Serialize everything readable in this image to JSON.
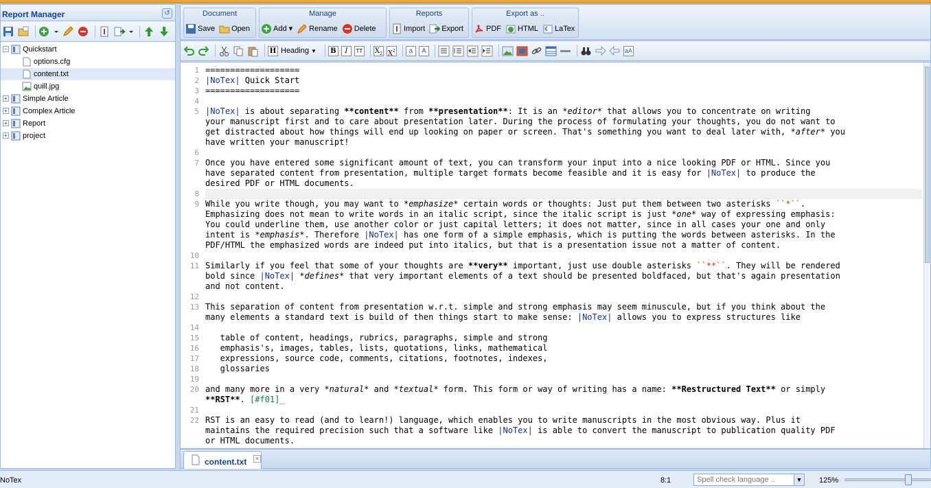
{
  "left_panel": {
    "title": "Report Manager",
    "tree": [
      {
        "label": "Quickstart",
        "type": "folder",
        "expanded": true
      },
      {
        "label": "options.cfg",
        "type": "file"
      },
      {
        "label": "content.txt",
        "type": "file",
        "selected": true
      },
      {
        "label": "quill.jpg",
        "type": "image"
      },
      {
        "label": "Simple Article",
        "type": "folder"
      },
      {
        "label": "Complex Article",
        "type": "folder"
      },
      {
        "label": "Report",
        "type": "folder"
      },
      {
        "label": "project",
        "type": "folder"
      }
    ]
  },
  "ribbon": {
    "document": {
      "title": "Document",
      "save": "Save",
      "open": "Open"
    },
    "manage": {
      "title": "Manage",
      "add": "Add",
      "rename": "Rename",
      "delete": "Delete"
    },
    "reports": {
      "title": "Reports",
      "import": "Import",
      "export": "Export"
    },
    "export_as": {
      "title": "Export as ..",
      "pdf": "PDF",
      "html": "HTML",
      "latex": "LaTex"
    }
  },
  "format_toolbar": {
    "heading": "Heading",
    "bold": "B",
    "italic": "I",
    "tt": "TT",
    "sub": "X",
    "sup": "X"
  },
  "editor": {
    "lines": [
      {
        "n": "1",
        "t": "==================="
      },
      {
        "n": "2",
        "t": "|NoTex| Quick Start"
      },
      {
        "n": "3",
        "t": "==================="
      },
      {
        "n": "4",
        "t": ""
      },
      {
        "n": "5",
        "t": "|NoTex| is about separating **content** from **presentation**: It is an *editor* that allows you to concentrate on writing"
      },
      {
        "n": "",
        "t": "your manuscript first and to care about presentation later. During the process of formulating your thoughts, you do not want to"
      },
      {
        "n": "",
        "t": "get distracted about how things will end up looking on paper or screen. That's something you want to deal later with, *after* you"
      },
      {
        "n": "",
        "t": "have written your manuscript!"
      },
      {
        "n": "6",
        "t": ""
      },
      {
        "n": "7",
        "t": "Once you have entered some significant amount of text, you can transform your input into a nice looking PDF or HTML. Since you"
      },
      {
        "n": "",
        "t": "have separated content from presentation, multiple target formats become feasible and it is easy for |NoTex| to produce the"
      },
      {
        "n": "",
        "t": "desired PDF or HTML documents."
      },
      {
        "n": "8",
        "t": ""
      },
      {
        "n": "9",
        "t": "While you write though, you may want to *emphasize* certain words or thoughts: Just put them between two asterisks ``*``."
      },
      {
        "n": "",
        "t": "Emphasizing does not mean to write words in an italic script, since the italic script is just *one* way of expressing emphasis:"
      },
      {
        "n": "",
        "t": "You could underline them, use another color or just capital letters; it does not matter, since in all cases your one and only"
      },
      {
        "n": "",
        "t": "intent is *emphasis*. Therefore |NoTex| has one form of a simple emphasis, which is putting the words between asterisks. In the"
      },
      {
        "n": "",
        "t": "PDF/HTML the emphasized words are indeed put into italics, but that is a presentation issue not a matter of content."
      },
      {
        "n": "10",
        "t": ""
      },
      {
        "n": "11",
        "t": "Similarly if you feel that some of your thoughts are **very** important, just use double asterisks ``**``. They will be rendered"
      },
      {
        "n": "",
        "t": "bold since |NoTex| *defines* that very important elements of a text should be presented boldfaced, but that's again presentation"
      },
      {
        "n": "",
        "t": "and not content."
      },
      {
        "n": "12",
        "t": ""
      },
      {
        "n": "13",
        "t": "This separation of content from presentation w.r.t. simple and strong emphasis may seem minuscule, but if you think about the"
      },
      {
        "n": "",
        "t": "many elements a standard text is build of then things start to make sense: |NoTex| allows you to express structures like"
      },
      {
        "n": "14",
        "t": ""
      },
      {
        "n": "15",
        "t": "   table of content, headings, rubrics, paragraphs, simple and strong"
      },
      {
        "n": "16",
        "t": "   emphasis's, images, tables, lists, quotations, links, mathematical"
      },
      {
        "n": "17",
        "t": "   expressions, source code, comments, citations, footnotes, indexes,"
      },
      {
        "n": "18",
        "t": "   glossaries"
      },
      {
        "n": "19",
        "t": ""
      },
      {
        "n": "20",
        "t": "and many more in a very *natural* and *textual* form. This form or way of writing has a name: **Restructured Text** or simply"
      },
      {
        "n": "",
        "t": "**RST**. [#f01]_"
      },
      {
        "n": "21",
        "t": ""
      },
      {
        "n": "22",
        "t": "RST is an easy to read (and to learn!) language, which enables you to write manuscripts in the most obvious way. Plus it"
      },
      {
        "n": "",
        "t": "maintains the required precision such that a software like |NoTex| is able to convert the manuscript to publication quality PDF"
      },
      {
        "n": "",
        "t": "or HTML documents."
      }
    ]
  },
  "tabs": [
    {
      "label": "content.txt"
    }
  ],
  "status": {
    "app": "NoTex",
    "cursor": "8:1",
    "spell_placeholder": "Spell check language ..",
    "zoom": "125%",
    "zoom_level": 0.75
  }
}
